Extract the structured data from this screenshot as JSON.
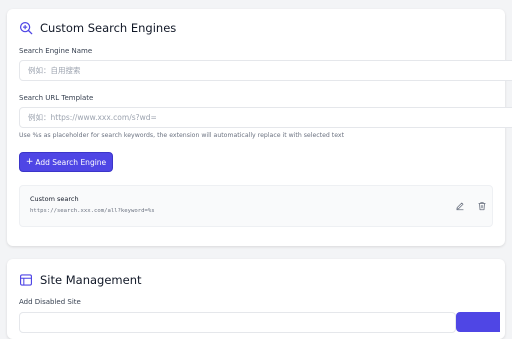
{
  "custom_search": {
    "title": "Custom Search Engines",
    "name_label": "Search Engine Name",
    "name_placeholder": "例如：自用搜索",
    "url_label": "Search URL Template",
    "url_placeholder": "例如：https://www.xxx.com/s?wd=",
    "hint": "Use %s as placeholder for search keywords, the extension will automatically replace it with selected text",
    "add_button": "Add Search Engine",
    "add_button_icon": "+",
    "engines": [
      {
        "name": "Custom search",
        "url": "https://search.xxx.com/all?keyword=%s"
      }
    ]
  },
  "site_management": {
    "title": "Site Management",
    "disabled_label": "Add Disabled Site"
  },
  "colors": {
    "accent": "#4f46e5",
    "title_icon": "#4f46e5"
  }
}
